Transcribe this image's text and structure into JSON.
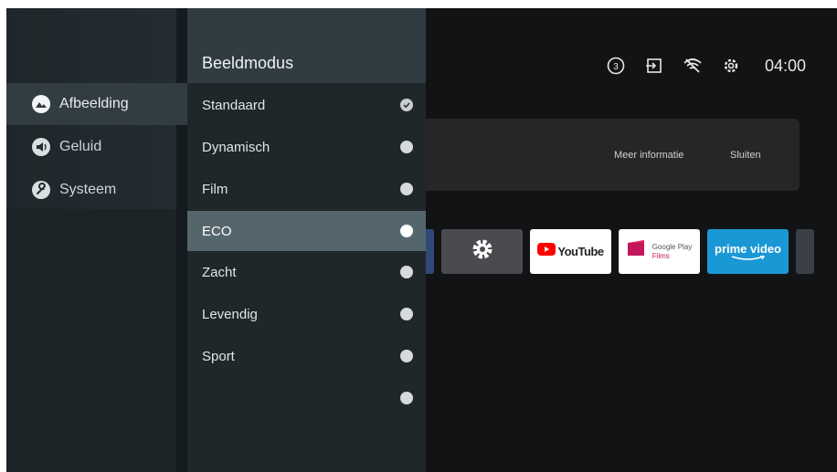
{
  "status_bar": {
    "notification_count": "3",
    "input_icon": "input-source-icon",
    "wifi_icon": "wifi-off-icon",
    "settings_icon": "gear-icon",
    "time": "04:00"
  },
  "banner": {
    "more_info": "Meer informatie",
    "close": "Sluiten"
  },
  "apps": {
    "youtube": "YouTube",
    "google_play_top": "Google Play",
    "google_play_bottom": "Films",
    "prime": "prime video"
  },
  "categories": [
    {
      "label": "Afbeelding",
      "icon": "picture-icon",
      "active": true
    },
    {
      "label": "Geluid",
      "icon": "speaker-icon",
      "active": false
    },
    {
      "label": "Systeem",
      "icon": "wrench-icon",
      "active": false
    }
  ],
  "submenu": {
    "title": "Beeldmodus",
    "items": [
      {
        "label": "Standaard",
        "state": "checked"
      },
      {
        "label": "Dynamisch",
        "state": "radio"
      },
      {
        "label": "Film",
        "state": "radio"
      },
      {
        "label": "ECO",
        "state": "focused"
      },
      {
        "label": "Zacht",
        "state": "radio"
      },
      {
        "label": "Levendig",
        "state": "radio"
      },
      {
        "label": "Sport",
        "state": "radio"
      },
      {
        "label": "",
        "state": "radio"
      }
    ]
  },
  "colors": {
    "focus_bg": "#55656c",
    "category_active_bg": "#323d43",
    "prime_blue": "#1a98d5",
    "youtube_red": "#ff0000"
  }
}
